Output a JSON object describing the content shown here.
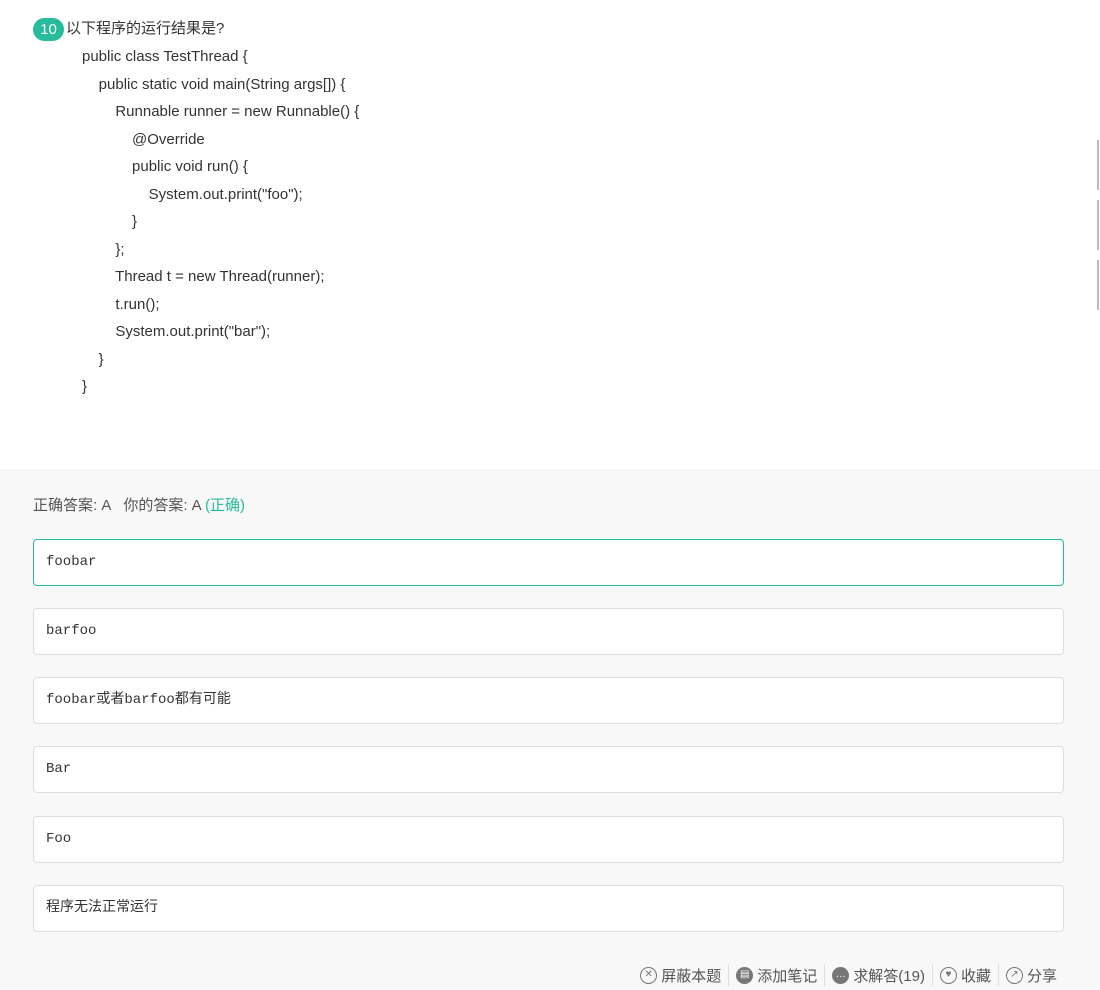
{
  "question": {
    "number": "10",
    "title": "以下程序的运行结果是?",
    "code_lines": [
      "public class TestThread {",
      "    public static void main(String args[]) {",
      "        Runnable runner = new Runnable() {",
      "            @Override",
      "            public void run() {",
      "                System.out.print(\"foo\");",
      "            }",
      "        };",
      "        Thread t = new Thread(runner);",
      "        t.run();",
      "        System.out.print(\"bar\");",
      "    }",
      "}"
    ]
  },
  "answer": {
    "correct_label": "正确答案: A",
    "yours_label": "你的答案: A",
    "result": "(正确)"
  },
  "options": [
    {
      "text": "foobar",
      "selected": true
    },
    {
      "text": "barfoo",
      "selected": false
    },
    {
      "text": "foobar或者barfoo都有可能",
      "selected": false
    },
    {
      "text": "Bar",
      "selected": false
    },
    {
      "text": "Foo",
      "selected": false
    },
    {
      "text": "程序无法正常运行",
      "selected": false
    }
  ],
  "actions": [
    {
      "label": "屏蔽本题",
      "icon": "block-icon"
    },
    {
      "label": "添加笔记",
      "icon": "notebook-icon"
    },
    {
      "label": "求解答(19)",
      "icon": "chat-bubble-icon"
    },
    {
      "label": "收藏",
      "icon": "heart-icon"
    },
    {
      "label": "分享",
      "icon": "share-icon"
    }
  ],
  "colors": {
    "accent": "#25bb9b",
    "option_border": "#dddddd",
    "answer_bg": "#f8f8f8"
  }
}
